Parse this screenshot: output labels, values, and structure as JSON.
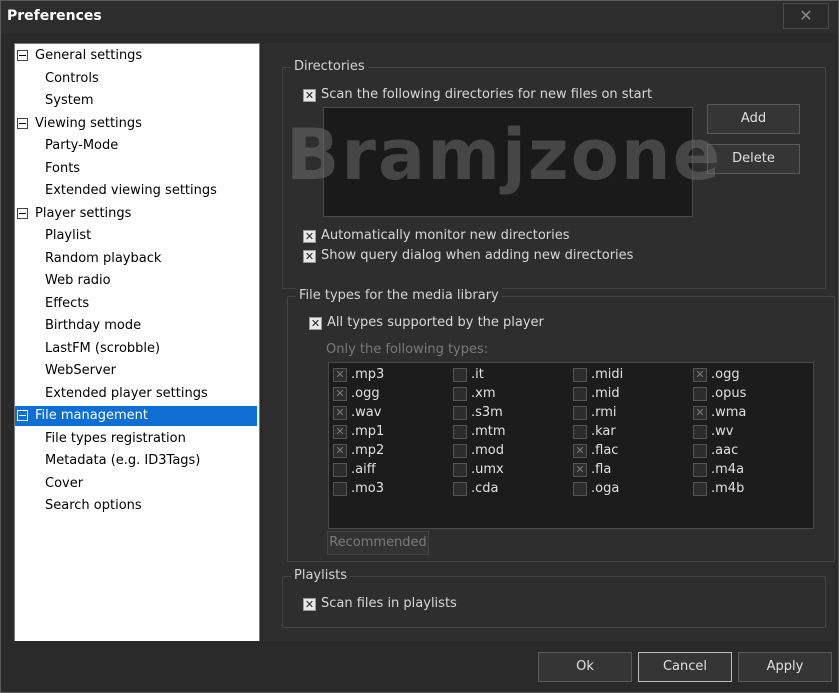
{
  "window": {
    "title": "Preferences",
    "close_label": "✕"
  },
  "tree": [
    {
      "label": "General settings",
      "level": 0
    },
    {
      "label": "Controls",
      "level": 1
    },
    {
      "label": "System",
      "level": 1
    },
    {
      "label": "Viewing settings",
      "level": 0
    },
    {
      "label": "Party-Mode",
      "level": 1
    },
    {
      "label": "Fonts",
      "level": 1
    },
    {
      "label": "Extended viewing settings",
      "level": 1
    },
    {
      "label": "Player settings",
      "level": 0
    },
    {
      "label": "Playlist",
      "level": 1
    },
    {
      "label": "Random playback",
      "level": 1
    },
    {
      "label": "Web radio",
      "level": 1
    },
    {
      "label": "Effects",
      "level": 1
    },
    {
      "label": "Birthday mode",
      "level": 1
    },
    {
      "label": "LastFM (scrobble)",
      "level": 1
    },
    {
      "label": "WebServer",
      "level": 1
    },
    {
      "label": "Extended player settings",
      "level": 1
    },
    {
      "label": "File management",
      "level": 0,
      "selected": true
    },
    {
      "label": "File types registration",
      "level": 1
    },
    {
      "label": "Metadata (e.g. ID3Tags)",
      "level": 1
    },
    {
      "label": "Cover",
      "level": 1
    },
    {
      "label": "Search options",
      "level": 1
    }
  ],
  "directories": {
    "title": "Directories",
    "scan_label": "Scan the following directories for new files on start",
    "scan_checked": true,
    "add_label": "Add",
    "delete_label": "Delete",
    "monitor_label": "Automatically monitor new directories",
    "monitor_checked": true,
    "query_label": "Show query dialog when adding new directories",
    "query_checked": true
  },
  "watermark": "Bramjzone",
  "filetypes": {
    "title": "File types for the media library",
    "all_label": "All types supported by the player",
    "all_checked": true,
    "only_label": "Only the following types:",
    "columns": [
      [
        {
          "ext": ".mp3",
          "checked": true
        },
        {
          "ext": ".ogg",
          "checked": true
        },
        {
          "ext": ".wav",
          "checked": true
        },
        {
          "ext": ".mp1",
          "checked": true
        },
        {
          "ext": ".mp2",
          "checked": true
        },
        {
          "ext": ".aiff",
          "checked": false
        },
        {
          "ext": ".mo3",
          "checked": false
        }
      ],
      [
        {
          "ext": ".it",
          "checked": false
        },
        {
          "ext": ".xm",
          "checked": false
        },
        {
          "ext": ".s3m",
          "checked": false
        },
        {
          "ext": ".mtm",
          "checked": false
        },
        {
          "ext": ".mod",
          "checked": false
        },
        {
          "ext": ".umx",
          "checked": false
        },
        {
          "ext": ".cda",
          "checked": false
        }
      ],
      [
        {
          "ext": ".midi",
          "checked": false
        },
        {
          "ext": ".mid",
          "checked": false
        },
        {
          "ext": ".rmi",
          "checked": false
        },
        {
          "ext": ".kar",
          "checked": false
        },
        {
          "ext": ".flac",
          "checked": true
        },
        {
          "ext": ".fla",
          "checked": true
        },
        {
          "ext": ".oga",
          "checked": false
        }
      ],
      [
        {
          "ext": ".ogg",
          "checked": true
        },
        {
          "ext": ".opus",
          "checked": false
        },
        {
          "ext": ".wma",
          "checked": true
        },
        {
          "ext": ".wv",
          "checked": false
        },
        {
          "ext": ".aac",
          "checked": false
        },
        {
          "ext": ".m4a",
          "checked": false
        },
        {
          "ext": ".m4b",
          "checked": false
        }
      ]
    ],
    "recommended_label": "Recommended"
  },
  "playlists": {
    "title": "Playlists",
    "scan_label": "Scan files in playlists",
    "scan_checked": true
  },
  "footer": {
    "ok_label": "Ok",
    "cancel_label": "Cancel",
    "apply_label": "Apply"
  },
  "icons": {
    "checkbox": "check-mark-icon",
    "expander": "collapse-minus-icon",
    "close": "close-icon"
  }
}
